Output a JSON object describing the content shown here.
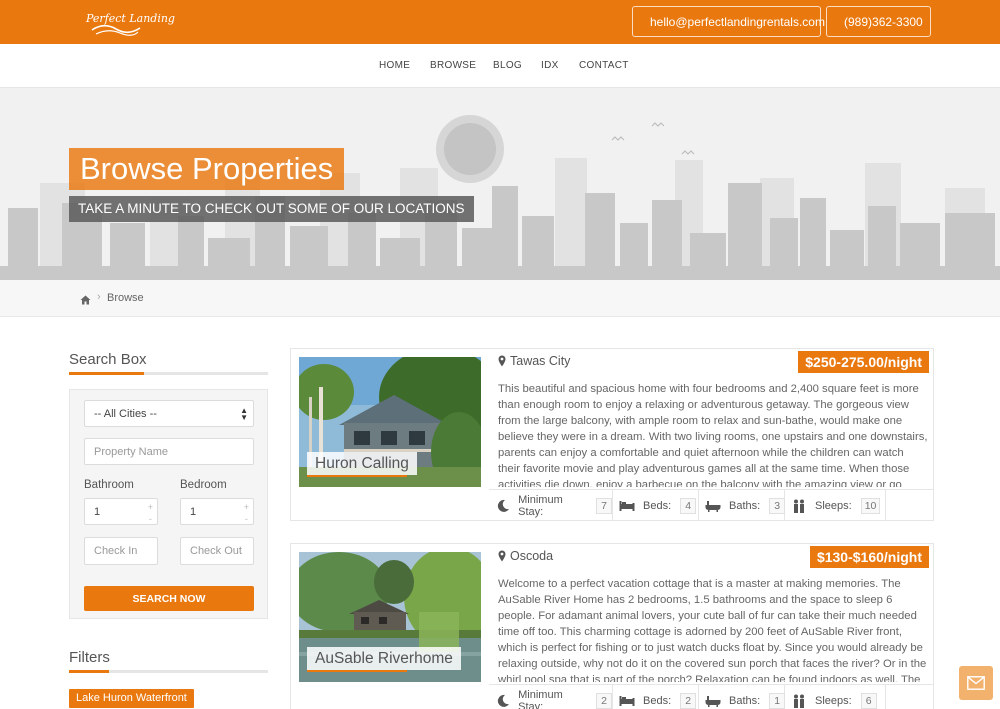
{
  "brand": {
    "logo_text": "Perfect Landing",
    "accent": "#e9780e"
  },
  "contact": {
    "email": "hello@perfectlandingrentals.com",
    "phone": "(989)362-3300"
  },
  "nav": {
    "items": [
      "HOME",
      "BROWSE",
      "BLOG",
      "IDX",
      "CONTACT"
    ]
  },
  "hero": {
    "title": "Browse Properties",
    "subtitle": "TAKE A MINUTE TO CHECK OUT SOME OF OUR LOCATIONS"
  },
  "breadcrumb": {
    "current": "Browse"
  },
  "sidebar": {
    "search_heading": "Search Box",
    "city_select": "-- All Cities --",
    "property_name_placeholder": "Property Name",
    "bathroom_label": "Bathroom",
    "bathroom_value": "1",
    "bedroom_label": "Bedroom",
    "bedroom_value": "1",
    "checkin_placeholder": "Check In",
    "checkout_placeholder": "Check Out",
    "search_button": "SEARCH NOW",
    "filters_heading": "Filters",
    "filter_tags": [
      "Lake Huron Waterfront"
    ]
  },
  "stat_labels": {
    "min_stay": "Minimum Stay:",
    "beds": "Beds:",
    "baths": "Baths:",
    "sleeps": "Sleeps:"
  },
  "listings": [
    {
      "name": "Huron Calling",
      "location": "Tawas City",
      "price": "$250-275.00/night",
      "description": "This beautiful and spacious home with four bedrooms and 2,400 square feet is more than enough room to enjoy a relaxing or adventurous getaway. The gorgeous view from the large balcony, with ample room to relax and sun-bathe, would make one believe they were in a dream. With two living rooms, one upstairs and one downstairs, parents can enjoy a comfortable and quiet afternoon while the children can watch their favorite movie and play adventurous games all at the same time. When those activities die down, enjoy a barbecue on the balcony with the amazing view or go",
      "min_stay": "7",
      "beds": "4",
      "baths": "3",
      "sleeps": "10"
    },
    {
      "name": "AuSable Riverhome",
      "location": "Oscoda",
      "price": "$130-$160/night",
      "description": "Welcome to a perfect vacation cottage that is a master at making memories. The AuSable River Home has 2 bedrooms, 1.5 bathrooms and the space to sleep 6 people. For adamant animal lovers, your cute ball of fur can take their much needed time off too. This charming cottage is adorned by 200 feet of AuSable River front, which is perfect for fishing or to just watch ducks float by. Since you would already be relaxing outside, why not do it on the covered sun porch that faces the river? Or in the whirl pool spa that is part of the porch? Relaxation can be found indoors as well. The house",
      "min_stay": "2",
      "beds": "2",
      "baths": "1",
      "sleeps": "6"
    }
  ]
}
